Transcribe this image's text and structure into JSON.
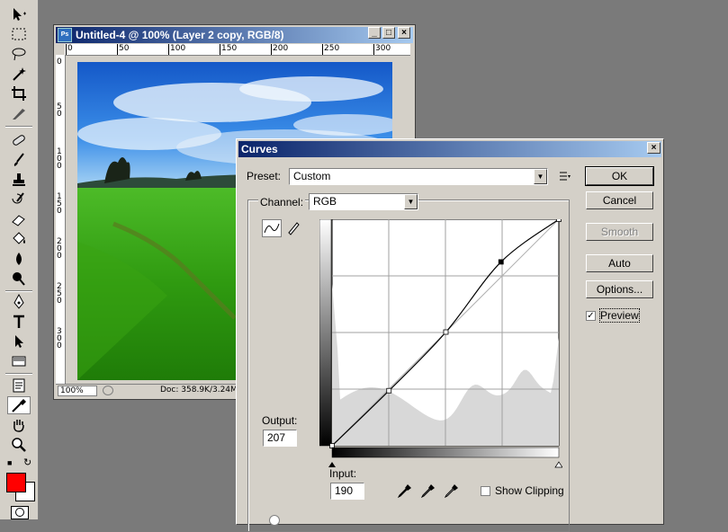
{
  "document": {
    "title": "Untitled-4 @ 100% (Layer 2 copy, RGB/8)",
    "zoom": "100%",
    "info": "Doc: 358.9K/3.24M",
    "ruler_h_labels": [
      "0",
      "50",
      "100",
      "150",
      "200",
      "250",
      "300"
    ],
    "ruler_v_labels": [
      "0",
      "5\n0",
      "1\n0\n0",
      "1\n5\n0",
      "2\n0\n0",
      "2\n5\n0",
      "3\n0\n0"
    ]
  },
  "curves": {
    "title": "Curves",
    "preset_label": "Preset:",
    "preset_value": "Custom",
    "channel_label": "Channel:",
    "channel_value": "RGB",
    "output_label": "Output:",
    "output_value": "207",
    "input_label": "Input:",
    "input_value": "190",
    "show_clipping_label": "Show Clipping",
    "buttons": {
      "ok": "OK",
      "cancel": "Cancel",
      "smooth": "Smooth",
      "auto": "Auto",
      "options": "Options...",
      "preview": "Preview"
    },
    "preview_checked": true,
    "curve_points": [
      [
        0,
        0
      ],
      [
        64,
        62
      ],
      [
        128,
        128
      ],
      [
        190,
        207
      ],
      [
        255,
        255
      ]
    ],
    "selected_point": [
      190,
      207
    ]
  },
  "colors": {
    "foreground": "#ff0000",
    "background": "#ffffff",
    "title_bar": "#0a246a"
  }
}
